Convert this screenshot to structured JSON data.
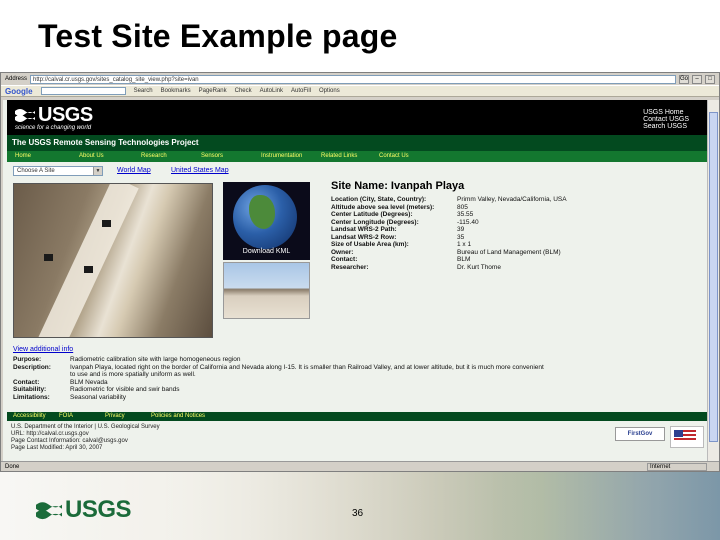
{
  "slide": {
    "title": "Test Site Example page",
    "page_number": "36",
    "logo_text": "USGS"
  },
  "browser": {
    "address_label": "Address",
    "address": "http://calval.cr.usgs.gov/sites_catalog_site_view.php?site=ivan",
    "go_label": "Go",
    "google_label": "Google",
    "google_toolbar_items": [
      "Search",
      "Bookmarks",
      "PageRank",
      "Check",
      "AutoLink",
      "AutoFill",
      "Options"
    ],
    "status_text": "Done",
    "status_zone": "Internet"
  },
  "usgs": {
    "logo_text": "USGS",
    "tagline": "science for a changing world",
    "header_links": [
      "USGS Home",
      "Contact USGS",
      "Search USGS"
    ],
    "project_title": "The USGS Remote Sensing Technologies Project",
    "nav": [
      "Home",
      "About Us",
      "Research",
      "Sensors",
      "Instrumentation",
      "Related Links",
      "Contact Us"
    ],
    "select_value": "Choose A Site",
    "world_map": "World Map",
    "us_map": "United States Map",
    "download_kml": "Download KML"
  },
  "site": {
    "name": "Site Name: Ivanpah Playa",
    "fields": [
      {
        "label": "Location (City, State, Country):",
        "value": "Primm Valley, Nevada/California, USA"
      },
      {
        "label": "Altitude above sea level (meters):",
        "value": "805"
      },
      {
        "label": "Center Latitude (Degrees):",
        "value": "35.55"
      },
      {
        "label": "Center Longitude (Degrees):",
        "value": "-115.40"
      },
      {
        "label": "Landsat WRS-2 Path:",
        "value": "39"
      },
      {
        "label": "Landsat WRS-2 Row:",
        "value": "35"
      },
      {
        "label": "Size of Usable Area (km):",
        "value": "1 x 1"
      },
      {
        "label": "Owner:",
        "value": "Bureau of Land Management (BLM)"
      },
      {
        "label": "Contact:",
        "value": "BLM"
      },
      {
        "label": "Researcher:",
        "value": "Dr. Kurt Thome"
      }
    ],
    "view_additional": "View additional info",
    "details": [
      {
        "label": "Purpose:",
        "value": "Radiometric calibration site with large homogeneous region"
      },
      {
        "label": "Description:",
        "value": "Ivanpah Playa, located right on the border of California and Nevada along I-15. It is smaller than Railroad Valley, and at lower altitude, but it is much more convenient to use and is more spatially uniform as well."
      },
      {
        "label": "Contact:",
        "value": "BLM Nevada"
      },
      {
        "label": "Suitability:",
        "value": "Radiometric for visible and swir bands"
      },
      {
        "label": "Limitations:",
        "value": "Seasonal variability"
      }
    ]
  },
  "footer": {
    "nav": [
      "Accessibility",
      "FOIA",
      "Privacy",
      "Policies and Notices"
    ],
    "lines": [
      "U.S. Department of the Interior | U.S. Geological Survey",
      "URL: http://calval.cr.usgs.gov",
      "Page Contact Information: calval@usgs.gov",
      "Page Last Modified: April 30, 2007"
    ],
    "firstgov": "FirstGov",
    "take_pride": "Take Pride in America"
  }
}
